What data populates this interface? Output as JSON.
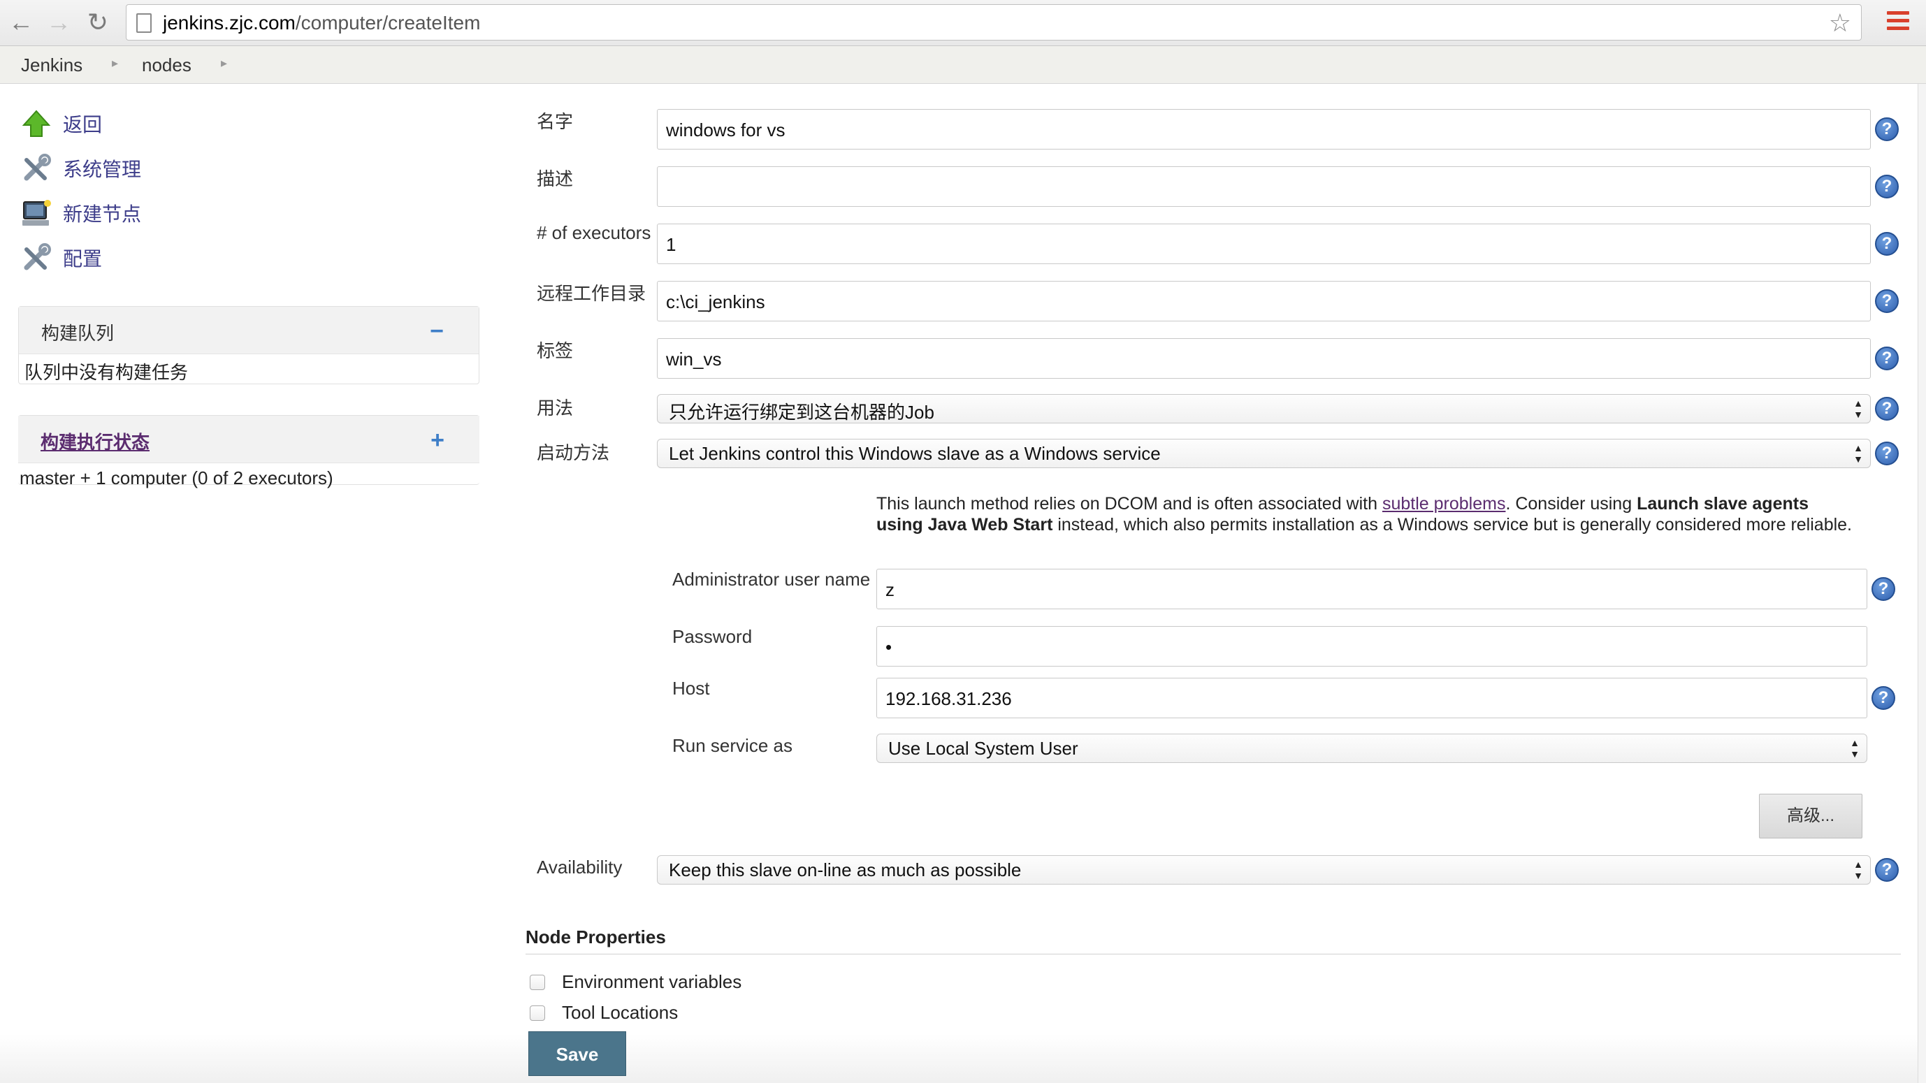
{
  "browser": {
    "url_host": "jenkins.zjc.com",
    "url_path": "/computer/createItem"
  },
  "breadcrumbs": [
    "Jenkins",
    "nodes"
  ],
  "sidebar": {
    "tasks": [
      {
        "label": "返回",
        "icon": "up-arrow-icon"
      },
      {
        "label": "系统管理",
        "icon": "tools-icon"
      },
      {
        "label": "新建节点",
        "icon": "computer-icon"
      },
      {
        "label": "配置",
        "icon": "tools-icon"
      }
    ],
    "build_queue": {
      "title": "构建队列",
      "toggle": "−",
      "empty_text": "队列中没有构建任务"
    },
    "executor_status": {
      "title": "构建执行状态",
      "toggle": "+",
      "summary": "master + 1 computer (0 of 2 executors)"
    }
  },
  "form": {
    "name": {
      "label": "名字",
      "value": "windows for vs"
    },
    "description": {
      "label": "描述",
      "value": ""
    },
    "executors": {
      "label": "# of executors",
      "value": "1"
    },
    "remote_fs": {
      "label": "远程工作目录",
      "value": "c:\\ci_jenkins"
    },
    "labels": {
      "label": "标签",
      "value": "win_vs"
    },
    "usage": {
      "label": "用法",
      "value": "只允许运行绑定到这台机器的Job"
    },
    "launch_method": {
      "label": "启动方法",
      "value": "Let Jenkins control this Windows slave as a Windows service"
    },
    "launch_note": {
      "text1": "This launch method relies on DCOM and is often associated with ",
      "link": "subtle problems",
      "text2": ". Consider using ",
      "bold": "Launch slave agents using Java Web Start",
      "text3": " instead, which also permits installation as a Windows service but is generally considered more reliable."
    },
    "admin_user": {
      "label": "Administrator user name",
      "value": "z"
    },
    "password": {
      "label": "Password",
      "value": "•"
    },
    "host": {
      "label": "Host",
      "value": "192.168.31.236"
    },
    "run_service_as": {
      "label": "Run service as",
      "value": "Use Local System User"
    },
    "advanced_button": "高级...",
    "availability": {
      "label": "Availability",
      "value": "Keep this slave on-line as much as possible"
    },
    "node_properties": {
      "title": "Node Properties",
      "options": [
        "Environment variables",
        "Tool Locations"
      ]
    },
    "save_button": "Save"
  },
  "help_icon_text": "?",
  "colors": {
    "link": "#5b2c6f",
    "save_button": "#4b758b",
    "help_icon": "#2f5fae"
  }
}
